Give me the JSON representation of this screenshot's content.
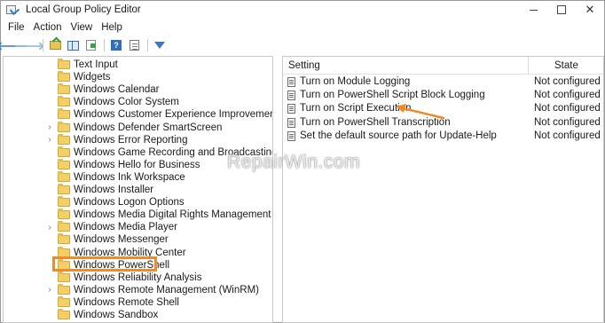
{
  "window": {
    "title": "Local Group Policy Editor",
    "controls": {
      "minimize": "",
      "maximize": "",
      "close": "✕"
    }
  },
  "menu": [
    "File",
    "Action",
    "View",
    "Help"
  ],
  "toolbar": {
    "icons": [
      "back-arrow-icon",
      "forward-arrow-icon",
      "up-folder-icon",
      "show-hide-tree-icon",
      "export-list-icon",
      "help-icon",
      "properties-icon",
      "filter-icon"
    ]
  },
  "tree": {
    "items": [
      {
        "label": "Text Input",
        "expandable": false
      },
      {
        "label": "Widgets",
        "expandable": false
      },
      {
        "label": "Windows Calendar",
        "expandable": false
      },
      {
        "label": "Windows Color System",
        "expandable": false
      },
      {
        "label": "Windows Customer Experience Improvement Program",
        "expandable": false
      },
      {
        "label": "Windows Defender SmartScreen",
        "expandable": true
      },
      {
        "label": "Windows Error Reporting",
        "expandable": true
      },
      {
        "label": "Windows Game Recording and Broadcasting",
        "expandable": false
      },
      {
        "label": "Windows Hello for Business",
        "expandable": false
      },
      {
        "label": "Windows Ink Workspace",
        "expandable": false
      },
      {
        "label": "Windows Installer",
        "expandable": false
      },
      {
        "label": "Windows Logon Options",
        "expandable": false
      },
      {
        "label": "Windows Media Digital Rights Management",
        "expandable": false
      },
      {
        "label": "Windows Media Player",
        "expandable": true
      },
      {
        "label": "Windows Messenger",
        "expandable": false
      },
      {
        "label": "Windows Mobility Center",
        "expandable": false
      },
      {
        "label": "Windows PowerShell",
        "expandable": false,
        "selected": true
      },
      {
        "label": "Windows Reliability Analysis",
        "expandable": false
      },
      {
        "label": "Windows Remote Management (WinRM)",
        "expandable": true
      },
      {
        "label": "Windows Remote Shell",
        "expandable": false
      },
      {
        "label": "Windows Sandbox",
        "expandable": false
      }
    ]
  },
  "list": {
    "columns": {
      "setting": "Setting",
      "state": "State"
    },
    "rows": [
      {
        "setting": "Turn on Module Logging",
        "state": "Not configured"
      },
      {
        "setting": "Turn on PowerShell Script Block Logging",
        "state": "Not configured"
      },
      {
        "setting": "Turn on Script Execution",
        "state": "Not configured"
      },
      {
        "setting": "Turn on PowerShell Transcription",
        "state": "Not configured"
      },
      {
        "setting": "Set the default source path for Update-Help",
        "state": "Not configured"
      }
    ]
  },
  "watermark": "RepairWin.com",
  "colors": {
    "highlight": "#f08a2a",
    "annotation_arrow": "#f08a2a"
  }
}
